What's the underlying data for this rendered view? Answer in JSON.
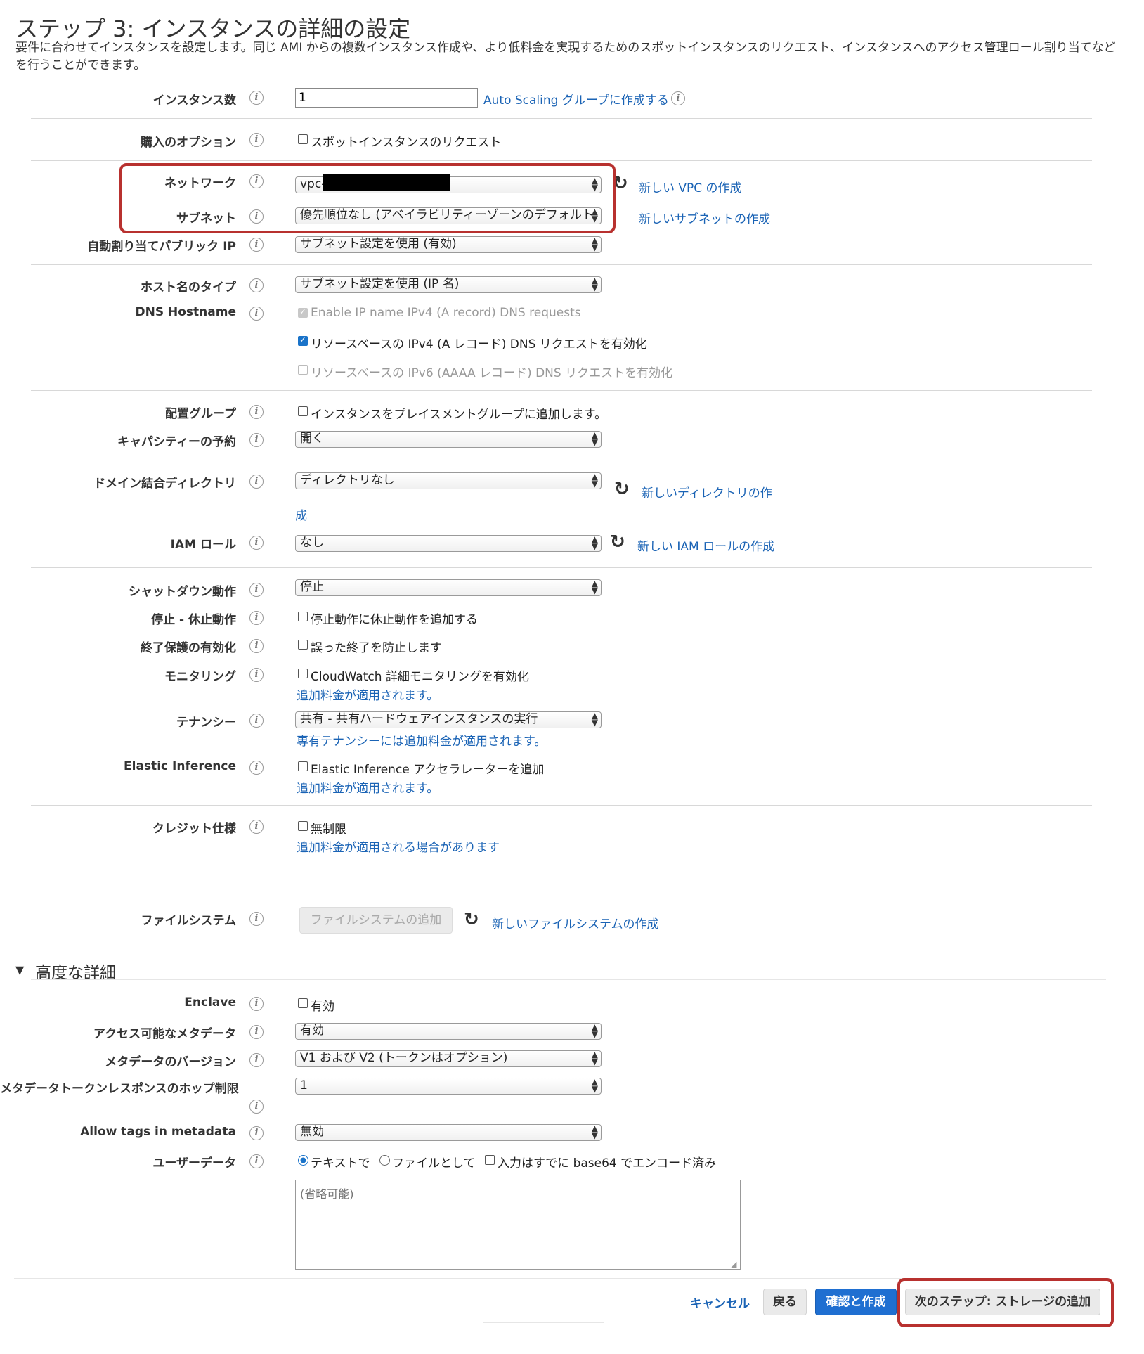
{
  "page": {
    "title": "ステップ 3: インスタンスの詳細の設定",
    "description": "要件に合わせてインスタンスを設定します。同じ AMI からの複数インスタンス作成や、より低料金を実現するためのスポットインスタンスのリクエスト、インスタンスへのアクセス管理ロール割り当てなどを行うことができます。"
  },
  "fields": {
    "instances": {
      "label": "インスタンス数",
      "value": "1",
      "link": "Auto Scaling グループに作成する"
    },
    "purchase": {
      "label": "購入のオプション",
      "checkbox": "スポットインスタンスのリクエスト"
    },
    "network": {
      "label": "ネットワーク",
      "value": "vpc-",
      "link": "新しい VPC の作成"
    },
    "subnet": {
      "label": "サブネット",
      "value": "優先順位なし (アベイラビリティーゾーンのデフォルト",
      "link": "新しいサブネットの作成"
    },
    "public_ip": {
      "label": "自動割り当てパブリック IP",
      "value": "サブネット設定を使用 (有効)"
    },
    "hostname_type": {
      "label": "ホスト名のタイプ",
      "value": "サブネット設定を使用 (IP 名)"
    },
    "dns_hostname": {
      "label": "DNS Hostname",
      "opt1": "Enable IP name IPv4 (A record) DNS requests",
      "opt2": "リソースベースの IPv4 (A レコード) DNS リクエストを有効化",
      "opt3": "リソースベースの IPv6 (AAAA レコード) DNS リクエストを有効化"
    },
    "placement": {
      "label": "配置グループ",
      "checkbox": "インスタンスをプレイスメントグループに追加します。"
    },
    "capacity": {
      "label": "キャパシティーの予約",
      "value": "開く"
    },
    "domain": {
      "label": "ドメイン結合ディレクトリ",
      "value": "ディレクトリなし",
      "link1": "新しいディレクトリの作",
      "link2": "成"
    },
    "iam": {
      "label": "IAM ロール",
      "value": "なし",
      "link": "新しい IAM ロールの作成"
    },
    "shutdown": {
      "label": "シャットダウン動作",
      "value": "停止"
    },
    "stop_hibernate": {
      "label": "停止 - 休止動作",
      "checkbox": "停止動作に休止動作を追加する"
    },
    "termination": {
      "label": "終了保護の有効化",
      "checkbox": "誤った終了を防止します"
    },
    "monitoring": {
      "label": "モニタリング",
      "checkbox": "CloudWatch 詳細モニタリングを有効化",
      "note": "追加料金が適用されます。"
    },
    "tenancy": {
      "label": "テナンシー",
      "value": "共有 - 共有ハードウェアインスタンスの実行",
      "note": "専有テナンシーには追加料金が適用されます。"
    },
    "elastic": {
      "label": "Elastic Inference",
      "checkbox": "Elastic Inference アクセラレーターを追加",
      "note": "追加料金が適用されます。"
    },
    "credit": {
      "label": "クレジット仕様",
      "checkbox": "無制限",
      "note": "追加料金が適用される場合があります"
    },
    "filesystem": {
      "label": "ファイルシステム",
      "button": "ファイルシステムの追加",
      "link": "新しいファイルシステムの作成"
    }
  },
  "advanced": {
    "heading": "高度な詳細",
    "enclave": {
      "label": "Enclave",
      "checkbox": "有効"
    },
    "metadata_access": {
      "label": "アクセス可能なメタデータ",
      "value": "有効"
    },
    "metadata_version": {
      "label": "メタデータのバージョン",
      "value": "V1 および V2 (トークンはオプション)"
    },
    "hop_limit": {
      "label": "メタデータトークンレスポンスのホップ制限",
      "value": "1"
    },
    "allow_tags": {
      "label": "Allow tags in metadata",
      "value": "無効"
    },
    "user_data": {
      "label": "ユーザーデータ",
      "radio1": "テキストで",
      "radio2": "ファイルとして",
      "checkbox": "入力はすでに base64 でエンコード済み",
      "placeholder": "(省略可能)"
    }
  },
  "footer": {
    "cancel": "キャンセル",
    "back": "戻る",
    "review": "確認と作成",
    "next": "次のステップ: ストレージの追加"
  },
  "colors": {
    "link": "#1a63b5",
    "primary": "#1f6fd1",
    "highlight": "#b8312f"
  }
}
